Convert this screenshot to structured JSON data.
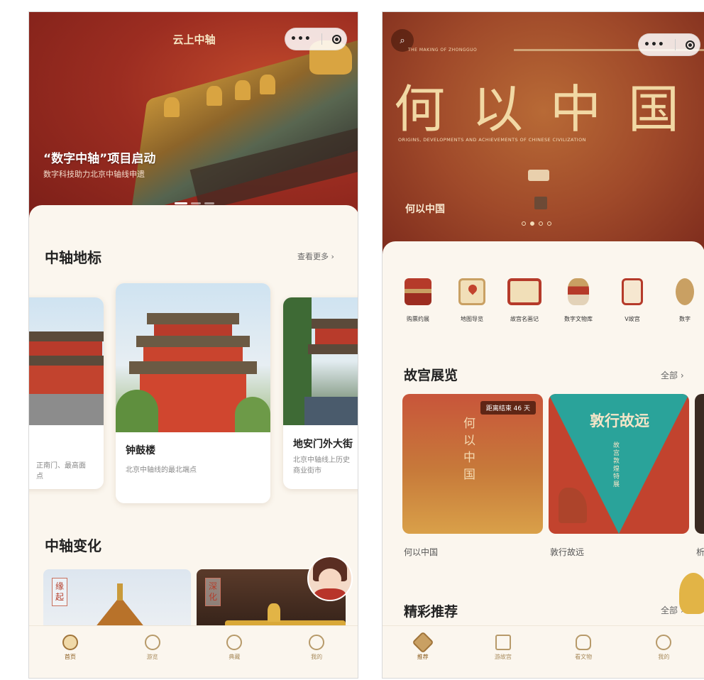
{
  "left_screen": {
    "nav_title": "云上中轴",
    "banner": {
      "headline": "“数字中轴”项目启动",
      "subtitle": "数字科技助力北京中轴线申遗"
    },
    "landmarks": {
      "title": "中轴地标",
      "more": "查看更多 ›",
      "cards": [
        {
          "name": "",
          "desc": "正南门、最高面\n点"
        },
        {
          "name": "钟鼓楼",
          "desc": "北京中轴线的最北端点"
        },
        {
          "name": "地安门外大街",
          "desc": "北京中轴线上历史\n商业街市"
        }
      ]
    },
    "changes": {
      "title": "中轴变化",
      "items": [
        {
          "tag": "缘起"
        },
        {
          "tag": "深化"
        }
      ]
    },
    "tabs": [
      "首页",
      "游览",
      "典藏",
      "我的"
    ]
  },
  "right_screen": {
    "banner": {
      "strip_text": "THE MAKING OF ZHONGGUO",
      "big_title": "何以中国",
      "english_line": "ORIGINS, DEVELOPMENTS AND ACHIEVEMENTS OF CHINESE CIVILIZATION",
      "caption": "何以中国"
    },
    "quick_entries": [
      "购票约展",
      "地图导览",
      "故宫名画记",
      "数字文物库",
      "V故宫",
      "数字"
    ],
    "exhibitions": {
      "title": "故宫展览",
      "more": "全部 ›",
      "items": [
        {
          "title": "何以中国",
          "badge": "距离结束 46 天",
          "poster": "何以中国"
        },
        {
          "title": "敦行故远",
          "poster": "敦行故远",
          "poster_sub": "故宫敦煌特展"
        },
        {
          "title": "析"
        }
      ]
    },
    "recommend": {
      "title": "精彩推荐",
      "more": "全部 ›"
    },
    "tabs": [
      "推荐",
      "游故宫",
      "看文物",
      "我的"
    ]
  },
  "colors": {
    "banner_red": "#9c2d21",
    "sheet_bg": "#fbf6ee",
    "gold": "#c9a063",
    "accent_teal": "#2aa39a"
  }
}
